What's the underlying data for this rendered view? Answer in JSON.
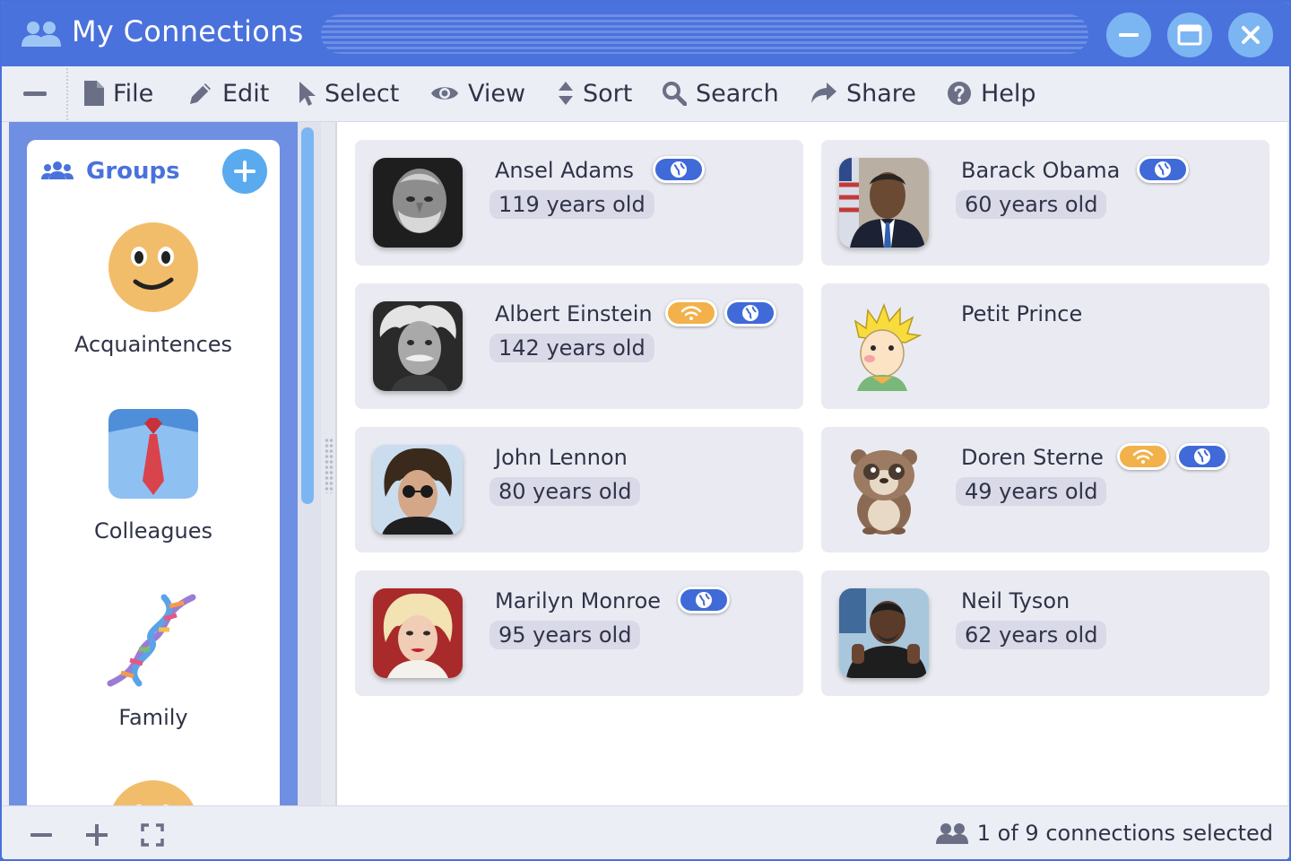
{
  "window": {
    "title": "My Connections",
    "accent_color": "#4a72dc",
    "controls": [
      "minimize-icon",
      "maximize-icon",
      "close-icon"
    ]
  },
  "toolbar": {
    "items": [
      {
        "label": "File",
        "icon": "file-icon"
      },
      {
        "label": "Edit",
        "icon": "pencil-icon"
      },
      {
        "label": "Select",
        "icon": "cursor-icon"
      },
      {
        "label": "View",
        "icon": "eye-icon"
      },
      {
        "label": "Sort",
        "icon": "sort-icon"
      },
      {
        "label": "Search",
        "icon": "search-icon"
      },
      {
        "label": "Share",
        "icon": "share-icon"
      },
      {
        "label": "Help",
        "icon": "help-icon"
      }
    ]
  },
  "sidebar": {
    "header": "Groups",
    "groups": [
      {
        "label": "Acquaintences",
        "icon": "smiley-face-icon"
      },
      {
        "label": "Colleagues",
        "icon": "tie-shirt-icon"
      },
      {
        "label": "Family",
        "icon": "dna-icon"
      },
      {
        "label": "",
        "icon": "smiley-face-icon"
      }
    ]
  },
  "connections": [
    {
      "name": "Ansel Adams",
      "age": "119 years old",
      "badges": [
        "web"
      ]
    },
    {
      "name": "Barack Obama",
      "age": "60 years old",
      "badges": [
        "web"
      ]
    },
    {
      "name": "Albert Einstein",
      "age": "142 years old",
      "badges": [
        "wifi",
        "web"
      ]
    },
    {
      "name": "Petit Prince",
      "age": "",
      "badges": []
    },
    {
      "name": "John Lennon",
      "age": "80 years old",
      "badges": []
    },
    {
      "name": "Doren Sterne",
      "age": "49 years old",
      "badges": [
        "wifi",
        "web"
      ]
    },
    {
      "name": "Marilyn Monroe",
      "age": "95 years old",
      "badges": [
        "web"
      ]
    },
    {
      "name": "Neil Tyson",
      "age": "62 years old",
      "badges": []
    }
  ],
  "statusbar": {
    "status": "1 of 9 connections selected",
    "buttons": [
      "zoom-out-icon",
      "zoom-in-icon",
      "fullscreen-icon"
    ]
  }
}
